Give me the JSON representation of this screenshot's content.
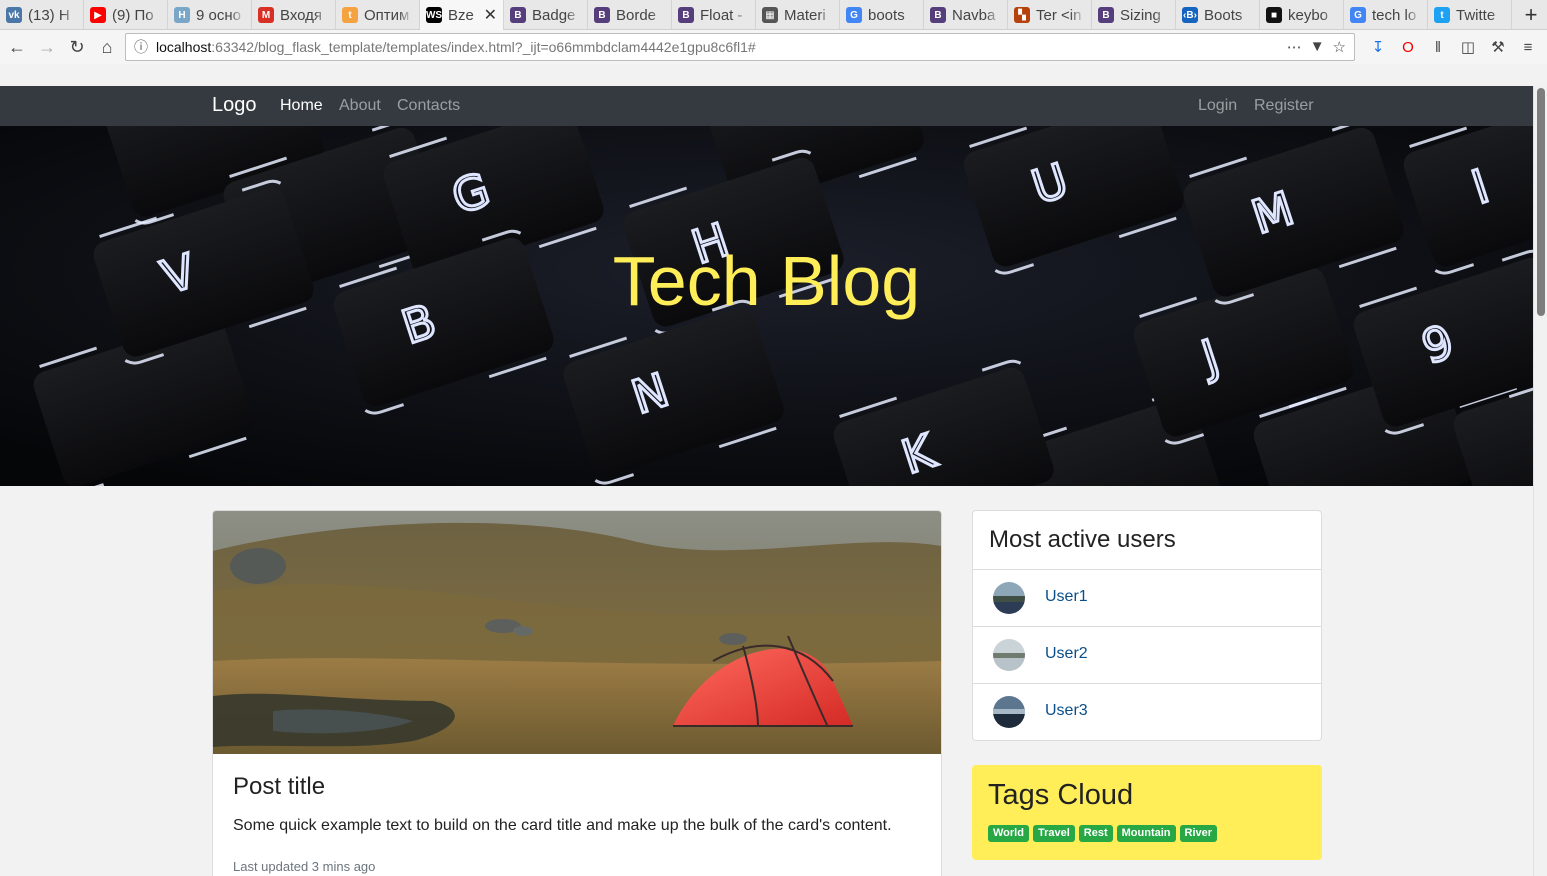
{
  "browser": {
    "tabs": [
      {
        "title": "(13) Н",
        "icon": "vk-icon",
        "color": "#4a76a8",
        "glyph": "vk"
      },
      {
        "title": "(9) По",
        "icon": "youtube-icon",
        "color": "#ff0000",
        "glyph": "▶"
      },
      {
        "title": "9 осно",
        "icon": "h-icon",
        "color": "#7aa7c7",
        "glyph": "H"
      },
      {
        "title": "Входя",
        "icon": "gmail-icon",
        "color": "#d93025",
        "glyph": "M"
      },
      {
        "title": "Оптим",
        "icon": "orange-circle-icon",
        "color": "#f4a340",
        "glyph": "t"
      },
      {
        "title": "Bze",
        "icon": "webstorm-icon",
        "color": "#000000",
        "glyph": "WS",
        "active": true
      },
      {
        "title": "Badge",
        "icon": "bootstrap-icon",
        "color": "#563d7c",
        "glyph": "B"
      },
      {
        "title": "Borde",
        "icon": "bootstrap-icon",
        "color": "#563d7c",
        "glyph": "B"
      },
      {
        "title": "Float -",
        "icon": "bootstrap-icon",
        "color": "#563d7c",
        "glyph": "B"
      },
      {
        "title": "Materi",
        "icon": "grid-icon",
        "color": "#555555",
        "glyph": "▦"
      },
      {
        "title": "boots",
        "icon": "google-icon",
        "color": "#4285f4",
        "glyph": "G"
      },
      {
        "title": "Navba",
        "icon": "bootstrap-icon",
        "color": "#563d7c",
        "glyph": "B"
      },
      {
        "title": "Ter <in",
        "icon": "colored-squares-icon",
        "color": "#b5410b",
        "glyph": "▚"
      },
      {
        "title": "Sizing",
        "icon": "bootstrap-icon",
        "color": "#563d7c",
        "glyph": "B"
      },
      {
        "title": "Boots",
        "icon": "bootstrap-blue-icon",
        "color": "#1565c0",
        "glyph": "‹B›"
      },
      {
        "title": "keybo",
        "icon": "dark-square-icon",
        "color": "#111111",
        "glyph": "■"
      },
      {
        "title": "tech lo",
        "icon": "google-icon",
        "color": "#4285f4",
        "glyph": "G"
      },
      {
        "title": "Twitte",
        "icon": "twitter-icon",
        "color": "#1da1f2",
        "glyph": "t"
      }
    ],
    "new_tab": "+",
    "url_host": "localhost",
    "url_path": ":63342/blog_flask_template/templates/index.html?_ijt=o66mmbdclam4442e1gpu8c6fl1#"
  },
  "site": {
    "brand": "Logo",
    "nav": {
      "home": "Home",
      "about": "About",
      "contacts": "Contacts",
      "login": "Login",
      "register": "Register"
    },
    "hero_title": "Tech Blog",
    "hero_keys": [
      "G",
      "H",
      "U",
      "V",
      "B",
      "N",
      "J",
      "K",
      "M",
      "I",
      "9"
    ]
  },
  "post": {
    "title": "Post title",
    "text": "Some quick example text to build on the card title and make up the bulk of the card's content.",
    "meta": "Last updated 3 mins ago"
  },
  "users": {
    "heading": "Most active users",
    "items": [
      "User1",
      "User2",
      "User3"
    ]
  },
  "tags": {
    "heading": "Tags Cloud",
    "items": [
      "World",
      "Travel",
      "Rest",
      "Mountain",
      "River"
    ],
    "color": "#28a745"
  },
  "colors": {
    "navbar": "#343a40",
    "hero_title": "#ffee58",
    "tags_bg": "#ffee58",
    "link": "#0b4f8a"
  }
}
